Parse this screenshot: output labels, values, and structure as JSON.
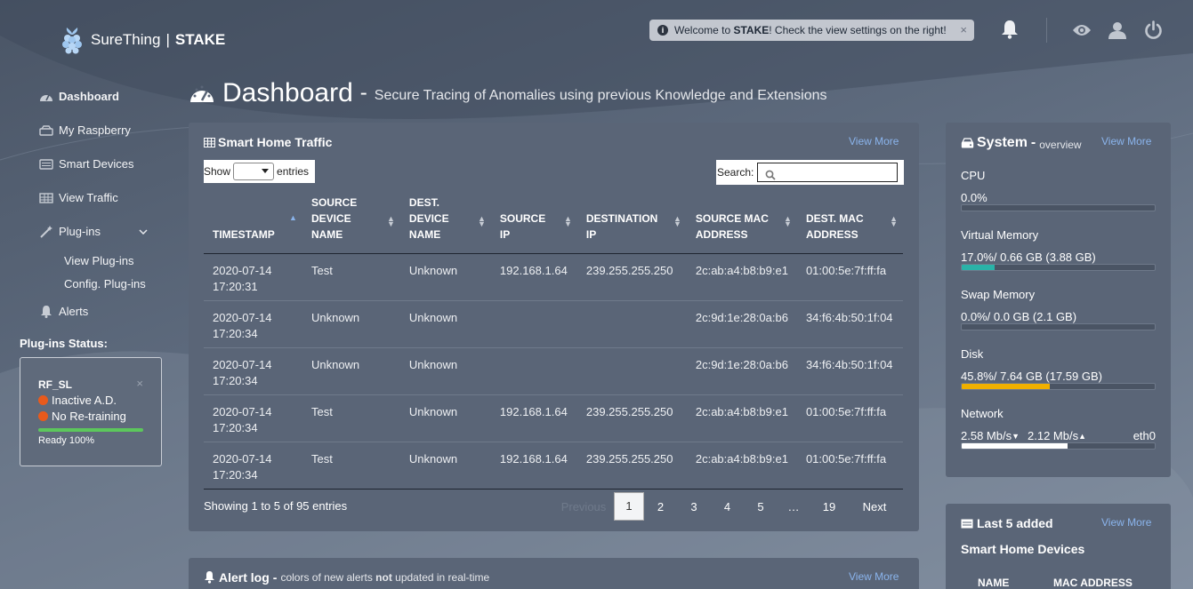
{
  "header": {
    "brand": "SureThing",
    "product": "STAKE",
    "welcome_pre": "Welcome to ",
    "welcome_bold": "STAKE",
    "welcome_post": "! Check the view settings on the right!",
    "welcome_close": "×"
  },
  "sidebar": {
    "items": [
      {
        "label": "Dashboard",
        "icon": "dashboard-icon"
      },
      {
        "label": "My Raspberry",
        "icon": "hdd-icon"
      },
      {
        "label": "Smart Devices",
        "icon": "list-icon"
      },
      {
        "label": "View Traffic",
        "icon": "table-icon"
      },
      {
        "label": "Plug-ins",
        "icon": "magic-wand-icon"
      },
      {
        "label": "View Plug-ins"
      },
      {
        "label": "Config. Plug-ins"
      },
      {
        "label": "Alerts",
        "icon": "bell-icon"
      }
    ],
    "plugins_status_title": "Plug-ins Status:",
    "plugin": {
      "name": "RF_SL",
      "close": "×",
      "status1": "Inactive A.D.",
      "status2": "No Re-training",
      "progress_label": "Ready 100%",
      "progress": 100
    }
  },
  "page": {
    "title": "Dashboard",
    "dash": "-",
    "subtitle": "Secure Tracing of Anomalies using previous Knowledge and Extensions"
  },
  "traffic": {
    "title": "Smart Home Traffic",
    "view_more": "View More",
    "show_label": "Show",
    "entries_label": "entries",
    "search_label": "Search:",
    "columns": [
      {
        "line1": "",
        "line2": "",
        "line3": "TIMESTAMP"
      },
      {
        "line1": "SOURCE",
        "line2": "DEVICE",
        "line3": "NAME"
      },
      {
        "line1": "DEST.",
        "line2": "DEVICE",
        "line3": "NAME"
      },
      {
        "line1": "",
        "line2": "SOURCE",
        "line3": "IP"
      },
      {
        "line1": "",
        "line2": "DESTINATION",
        "line3": "IP"
      },
      {
        "line1": "",
        "line2": "SOURCE MAC",
        "line3": "ADDRESS"
      },
      {
        "line1": "",
        "line2": "DEST. MAC",
        "line3": "ADDRESS"
      }
    ],
    "rows": [
      {
        "date": "2020-07-14",
        "time": "17:20:31",
        "src_name": "Test",
        "dst_name": "Unknown",
        "src_ip": "192.168.1.64",
        "dst_ip": "239.255.255.250",
        "src_mac": "2c:ab:a4:b8:b9:e1",
        "dst_mac": "01:00:5e:7f:ff:fa"
      },
      {
        "date": "2020-07-14",
        "time": "17:20:34",
        "src_name": "Unknown",
        "dst_name": "Unknown",
        "src_ip": "",
        "dst_ip": "",
        "src_mac": "2c:9d:1e:28:0a:b6",
        "dst_mac": "34:f6:4b:50:1f:04"
      },
      {
        "date": "2020-07-14",
        "time": "17:20:34",
        "src_name": "Unknown",
        "dst_name": "Unknown",
        "src_ip": "",
        "dst_ip": "",
        "src_mac": "2c:9d:1e:28:0a:b6",
        "dst_mac": "34:f6:4b:50:1f:04"
      },
      {
        "date": "2020-07-14",
        "time": "17:20:34",
        "src_name": "Test",
        "dst_name": "Unknown",
        "src_ip": "192.168.1.64",
        "dst_ip": "239.255.255.250",
        "src_mac": "2c:ab:a4:b8:b9:e1",
        "dst_mac": "01:00:5e:7f:ff:fa"
      },
      {
        "date": "2020-07-14",
        "time": "17:20:34",
        "src_name": "Test",
        "dst_name": "Unknown",
        "src_ip": "192.168.1.64",
        "dst_ip": "239.255.255.250",
        "src_mac": "2c:ab:a4:b8:b9:e1",
        "dst_mac": "01:00:5e:7f:ff:fa"
      }
    ],
    "showing": "Showing 1 to 5 of 95 entries",
    "pagination": {
      "previous": "Previous",
      "pages": [
        "1",
        "2",
        "3",
        "4",
        "5",
        "…",
        "19"
      ],
      "next": "Next",
      "current": "1"
    }
  },
  "system": {
    "title": "System",
    "dash": "-",
    "subtitle": "overview",
    "view_more": "View More",
    "metrics": [
      {
        "label": "CPU",
        "value": "0.0%",
        "percent": 0,
        "color": "#2ab3a8"
      },
      {
        "label": "Virtual Memory",
        "value": "17.0%/ 0.66 GB (3.88 GB)",
        "percent": 17,
        "color": "#2ab3a8"
      },
      {
        "label": "Swap Memory",
        "value": "0.0%/ 0.0 GB (2.1 GB)",
        "percent": 0,
        "color": "#2ab3a8"
      },
      {
        "label": "Disk",
        "value": "45.8%/ 7.64 GB (17.59 GB)",
        "percent": 45.8,
        "color": "#f0b000"
      }
    ],
    "network": {
      "label": "Network",
      "down": "2.58 Mb/s",
      "up": "2.12 Mb/s",
      "iface": "eth0",
      "percent": 55,
      "color": "#ffffff"
    }
  },
  "last_added": {
    "title": "Last 5 added",
    "view_more": "View More",
    "subtitle": "Smart Home Devices",
    "col_name": "NAME",
    "col_mac": "MAC ADDRESS"
  },
  "alert_log": {
    "title": "Alert log",
    "dash": "-",
    "note_pre": "colors of new alerts ",
    "note_bold": "not",
    "note_post": " updated in real-time",
    "view_more": "View More"
  }
}
